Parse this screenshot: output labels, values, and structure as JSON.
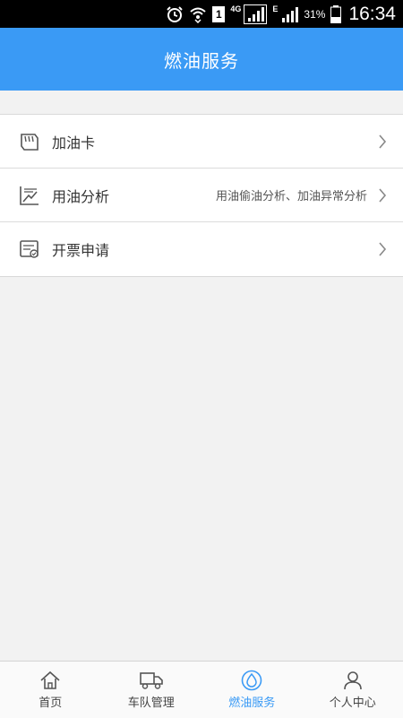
{
  "status_bar": {
    "sim": "1",
    "network_4g": "4G",
    "network_e": "E",
    "battery": "31%",
    "time": "16:34"
  },
  "header": {
    "title": "燃油服务"
  },
  "menu": {
    "items": [
      {
        "label": "加油卡",
        "subtitle": ""
      },
      {
        "label": "用油分析",
        "subtitle": "用油偷油分析、加油异常分析"
      },
      {
        "label": "开票申请",
        "subtitle": ""
      }
    ]
  },
  "tabs": {
    "items": [
      {
        "label": "首页",
        "icon": "home-icon"
      },
      {
        "label": "车队管理",
        "icon": "truck-icon"
      },
      {
        "label": "燃油服务",
        "icon": "fuel-drop-icon"
      },
      {
        "label": "个人中心",
        "icon": "person-icon"
      }
    ],
    "active_index": 2
  },
  "colors": {
    "accent": "#3a9af5",
    "header_bg": "#3a9af5",
    "page_bg": "#f2f2f2"
  }
}
